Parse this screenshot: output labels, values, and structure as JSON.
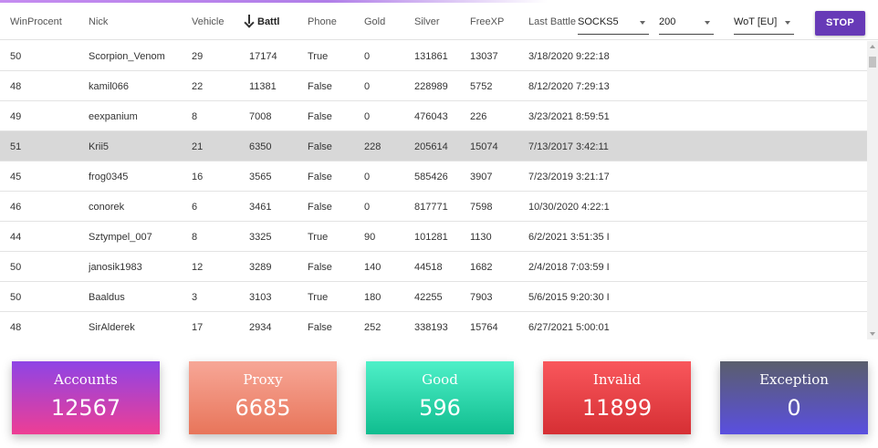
{
  "header": {
    "columns": [
      "WinProcent",
      "Nick",
      "Vehicle",
      "Battl",
      "Phone",
      "Gold",
      "Silver",
      "FreeXP",
      "Last Battle"
    ],
    "sorted_column": "Battl",
    "proxy_type": "SOCKS5",
    "threads": "200",
    "server": "WoT [EU]",
    "stop_label": "STOP"
  },
  "rows": [
    {
      "win": "50",
      "nick": "Scorpion_Venom",
      "vehicle": "29",
      "battles": "17174",
      "phone": "True",
      "gold": "0",
      "silver": "131861",
      "freexp": "13037",
      "last": "3/18/2020 9:22:18"
    },
    {
      "win": "48",
      "nick": "kamil066",
      "vehicle": "22",
      "battles": "11381",
      "phone": "False",
      "gold": "0",
      "silver": "228989",
      "freexp": "5752",
      "last": "8/12/2020 7:29:13"
    },
    {
      "win": "49",
      "nick": "eexpanium",
      "vehicle": "8",
      "battles": "7008",
      "phone": "False",
      "gold": "0",
      "silver": "476043",
      "freexp": "226",
      "last": "3/23/2021 8:59:51"
    },
    {
      "win": "51",
      "nick": "Krii5",
      "vehicle": "21",
      "battles": "6350",
      "phone": "False",
      "gold": "228",
      "silver": "205614",
      "freexp": "15074",
      "last": "7/13/2017 3:42:11"
    },
    {
      "win": "45",
      "nick": "frog0345",
      "vehicle": "16",
      "battles": "3565",
      "phone": "False",
      "gold": "0",
      "silver": "585426",
      "freexp": "3907",
      "last": "7/23/2019 3:21:17"
    },
    {
      "win": "46",
      "nick": "conorek",
      "vehicle": "6",
      "battles": "3461",
      "phone": "False",
      "gold": "0",
      "silver": "817771",
      "freexp": "7598",
      "last": "10/30/2020 4:22:1"
    },
    {
      "win": "44",
      "nick": "Sztympel_007",
      "vehicle": "8",
      "battles": "3325",
      "phone": "True",
      "gold": "90",
      "silver": "101281",
      "freexp": "1130",
      "last": "6/2/2021 3:51:35 I"
    },
    {
      "win": "50",
      "nick": "janosik1983",
      "vehicle": "12",
      "battles": "3289",
      "phone": "False",
      "gold": "140",
      "silver": "44518",
      "freexp": "1682",
      "last": "2/4/2018 7:03:59 I"
    },
    {
      "win": "50",
      "nick": "Baaldus",
      "vehicle": "3",
      "battles": "3103",
      "phone": "True",
      "gold": "180",
      "silver": "42255",
      "freexp": "7903",
      "last": "5/6/2015 9:20:30 I"
    },
    {
      "win": "48",
      "nick": "SirAlderek",
      "vehicle": "17",
      "battles": "2934",
      "phone": "False",
      "gold": "252",
      "silver": "338193",
      "freexp": "15764",
      "last": "6/27/2021 5:00:01"
    }
  ],
  "selected_row_index": 3,
  "stats": {
    "accounts": {
      "label": "Accounts",
      "value": "12567"
    },
    "proxy": {
      "label": "Proxy",
      "value": "6685"
    },
    "good": {
      "label": "Good",
      "value": "596"
    },
    "invalid": {
      "label": "Invalid",
      "value": "11899"
    },
    "exception": {
      "label": "Exception",
      "value": "0"
    }
  },
  "colors": {
    "accent": "#673ab7",
    "row_selected": "#d8d8d8"
  },
  "icons": {
    "sort": "arrow-down-icon",
    "dropdown": "caret-down-icon"
  }
}
